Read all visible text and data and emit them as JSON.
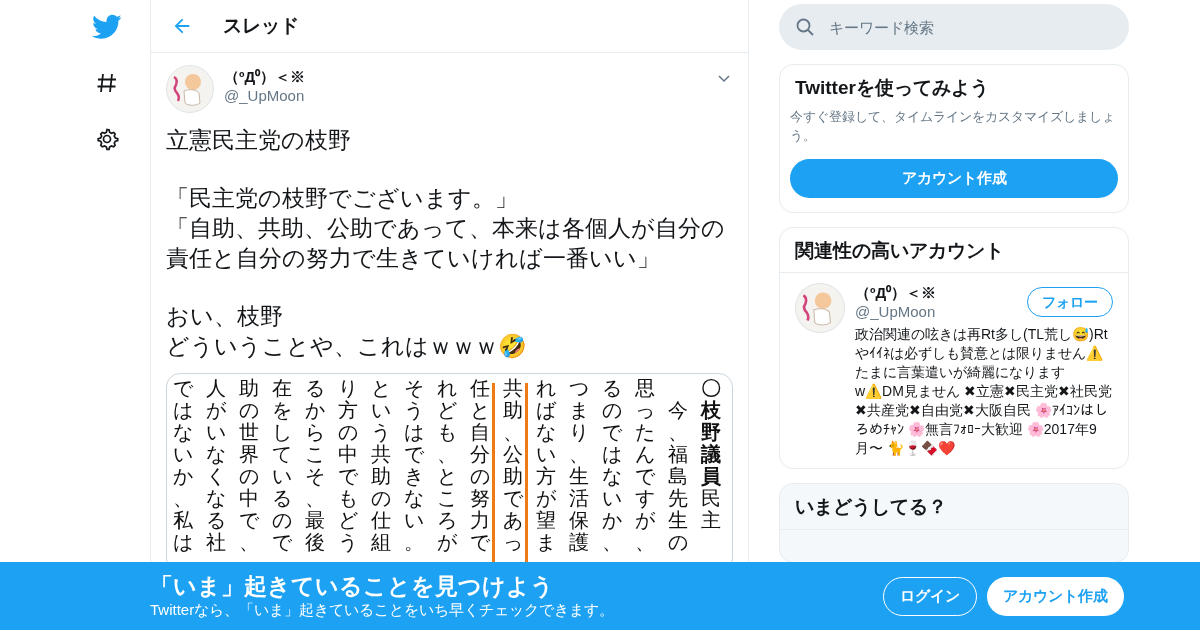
{
  "nav": {
    "items": [
      {
        "kind": "logo"
      },
      {
        "kind": "explore"
      },
      {
        "kind": "settings"
      }
    ]
  },
  "header": {
    "title": "スレッド"
  },
  "tweet": {
    "author": {
      "name": "（ºД⁰）＜※",
      "handle": "@_UpMoon"
    },
    "paragraphs": [
      [
        "立憲民主党の枝野"
      ],
      [
        "「民主党の枝野でございます。」",
        "「自助、共助、公助であって、本来は各個人が自分の責任と自分の努力で生きていければ一番いい」"
      ],
      [
        "おい、枝野",
        "どういうことや、これはｗｗｗ🤣"
      ]
    ],
    "document": {
      "columns": [
        {
          "text": "ではないか、私は",
          "marked": false
        },
        {
          "text": "人がいなくなる社",
          "marked": false
        },
        {
          "text": "助の世界の中で、",
          "marked": false
        },
        {
          "text": "在をしているので",
          "marked": false
        },
        {
          "text": "るからこそ、最後",
          "marked": false
        },
        {
          "text": "り方の中でもどう",
          "marked": false
        },
        {
          "text": "という共助の仕組",
          "marked": false
        },
        {
          "text": "そうはできない。",
          "marked": false
        },
        {
          "text": "れども、ところが",
          "marked": false
        },
        {
          "text": "任と自分の努力で",
          "marked": true
        },
        {
          "text": "共助、公助であっ",
          "marked": true
        },
        {
          "text": "ればない方が望ま",
          "marked": false
        },
        {
          "text": "つまり、生活保護",
          "marked": false
        },
        {
          "text": "るのではないか、",
          "marked": false
        },
        {
          "text": "思ったんですが、",
          "marked": false
        },
        {
          "text": "　今、福島先生の",
          "marked": false
        },
        {
          "text": "**〇枝野議員**民主",
          "marked": false
        }
      ]
    }
  },
  "search": {
    "placeholder": "キーワード検索"
  },
  "signup_card": {
    "title": "Twitterを使ってみよう",
    "text": "今すぐ登録して、タイムラインをカスタマイズしましょう。",
    "button": "アカウント作成"
  },
  "related": {
    "title": "関連性の高いアカウント",
    "accounts": [
      {
        "name": "（ºД⁰）＜※",
        "handle": "@_UpMoon",
        "button": "フォロー",
        "bio": "政治関連の呟きは再Rt多し(TL荒し😅)Rtやｲｲﾈは必ずしも賛意とは限りません⚠️たまに言葉遣いが綺麗になりますw⚠️DM見ません ✖立憲✖民主党✖社民党✖共産党✖自由党✖大阪自民 🌸ｱｲｺﾝはしろめﾁｬﾝ 🌸無言ﾌｫﾛｰ大歓迎 🌸2017年9月〜 🐈🍷🍫❤️"
      }
    ]
  },
  "trends": {
    "title": "いまどうしてる？"
  },
  "banner": {
    "title": "「いま」起きていることを見つけよう",
    "text": "Twitterなら、「いま」起きていることをいち早くチェックできます。",
    "buttons": [
      {
        "label": "ログイン",
        "kind": "outline"
      },
      {
        "label": "アカウント作成",
        "kind": "solid"
      }
    ]
  }
}
